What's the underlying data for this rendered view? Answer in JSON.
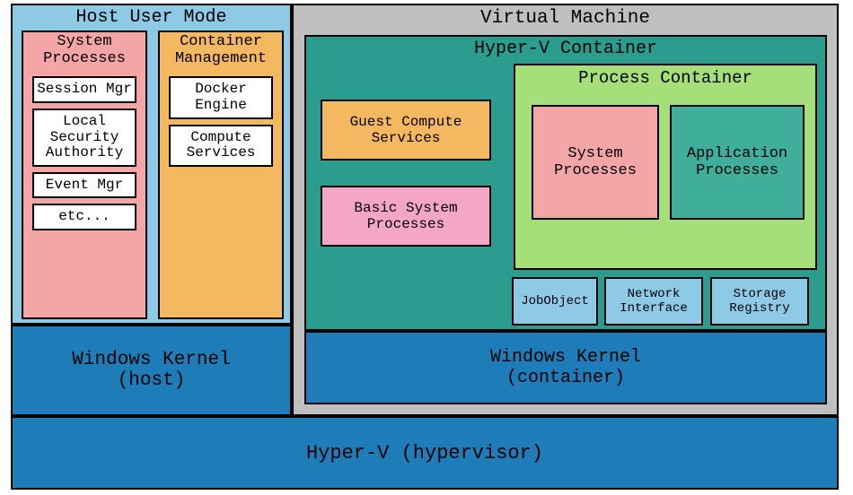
{
  "hypervisor": {
    "label": "Hyper-V (hypervisor)"
  },
  "host_user_mode": {
    "title": "Host User Mode",
    "system_processes": {
      "title": "System\nProcesses",
      "items": [
        "Session Mgr",
        "Local Security Authority",
        "Event Mgr",
        "etc..."
      ]
    },
    "container_management": {
      "title": "Container\nManagement",
      "items": [
        "Docker Engine",
        "Compute Services"
      ]
    }
  },
  "windows_kernel_host": {
    "label": "Windows Kernel\n(host)"
  },
  "virtual_machine": {
    "title": "Virtual Machine",
    "hyperv_container": {
      "title": "Hyper-V Container",
      "guest_compute": "Guest Compute Services",
      "basic_system": "Basic System Processes",
      "process_container": {
        "title": "Process Container",
        "system_processes": "System Processes",
        "application_processes": "Application Processes"
      },
      "bottom": {
        "jobobject": "JobObject",
        "network_interface": "Network Interface",
        "storage_registry": "Storage Registry"
      }
    },
    "windows_kernel_container": {
      "label": "Windows Kernel\n(container)"
    }
  },
  "colors": {
    "blue": "#1e7db8",
    "lightblue": "#8ecae6",
    "grey": "#bfbfbf",
    "teal": "#2a9d8f",
    "green": "#a4df7a",
    "lightteal": "#3fae9a",
    "pink": "#f4a6a6",
    "pink2": "#f4a6c6",
    "orange": "#f4b860"
  }
}
